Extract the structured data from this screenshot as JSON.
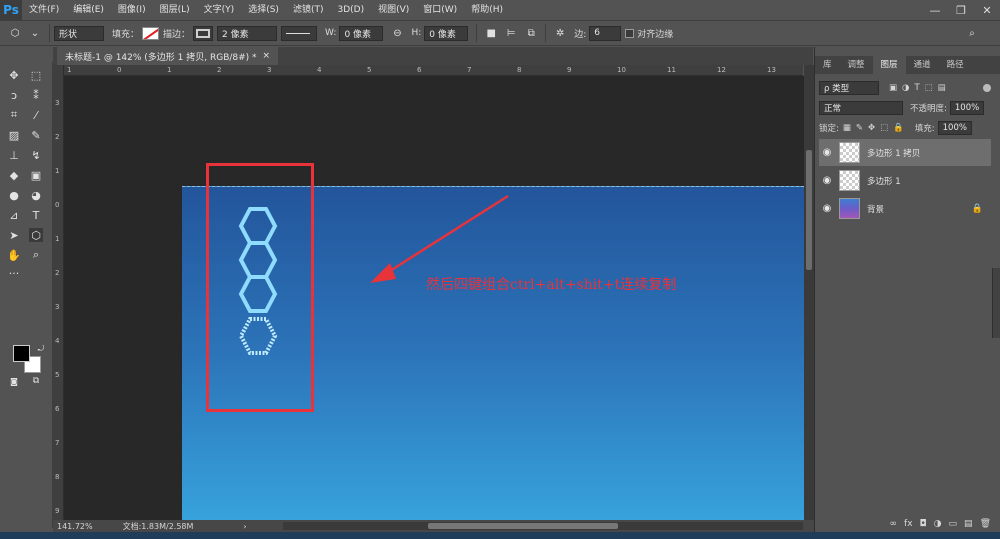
{
  "app": {
    "logo": "Ps"
  },
  "menu": [
    "文件(F)",
    "编辑(E)",
    "图像(I)",
    "图层(L)",
    "文字(Y)",
    "选择(S)",
    "滤镜(T)",
    "3D(D)",
    "视图(V)",
    "窗口(W)",
    "帮助(H)"
  ],
  "window_controls": {
    "minimize": "—",
    "restore": "❐",
    "close": "✕"
  },
  "options": {
    "mode": "形状",
    "fill_label": "填充：",
    "stroke_label": "描边：",
    "stroke_size": "2 像素",
    "w_label": "W:",
    "w_value": "0 像素",
    "link": "⊖",
    "h_label": "H:",
    "h_value": "0 像素",
    "sides_label": "边:",
    "sides_value": "6",
    "align_edges": "对齐边缘"
  },
  "document": {
    "tab_title": "未标题-1 @ 142% (多边形 1 拷贝, RGB/8#) *",
    "tab_close": "×",
    "annotation": "然后四键组合ctrl+alt+shit+t连续复制"
  },
  "ruler": {
    "top": [
      "1",
      "0",
      "1",
      "2",
      "3",
      "4",
      "5",
      "6",
      "7",
      "8",
      "9",
      "10",
      "11",
      "12",
      "13"
    ],
    "left": [
      "3",
      "2",
      "1",
      "0",
      "1",
      "2",
      "3",
      "4",
      "5",
      "6",
      "7",
      "8",
      "9",
      "1"
    ]
  },
  "status": {
    "zoom": "141.72%",
    "doc": "文档:1.83M/2.58M",
    "arrow": "›"
  },
  "panel": {
    "tabs": [
      "库",
      "调整",
      "图层",
      "通道",
      "路径"
    ],
    "active_tab": 2,
    "filter_kind": "ρ 类型",
    "blend_mode": "正常",
    "opacity_label": "不透明度:",
    "opacity_value": "100%",
    "lock_label": "锁定:",
    "fill_label": "填充:",
    "fill_value": "100%",
    "layers": [
      {
        "name": "多边形 1 拷贝",
        "selected": true
      },
      {
        "name": "多边形 1",
        "selected": false
      },
      {
        "name": "背景",
        "selected": false,
        "locked": true
      }
    ],
    "footer_icons": [
      "∞",
      "fx",
      "◘",
      "◑",
      "▭",
      "▤",
      "🗑"
    ]
  },
  "colors": {
    "accent_red": "#e8333b",
    "hex_outline": "#8fdcff",
    "canvas_top": "#23559b",
    "canvas_bottom": "#37a2dc"
  }
}
